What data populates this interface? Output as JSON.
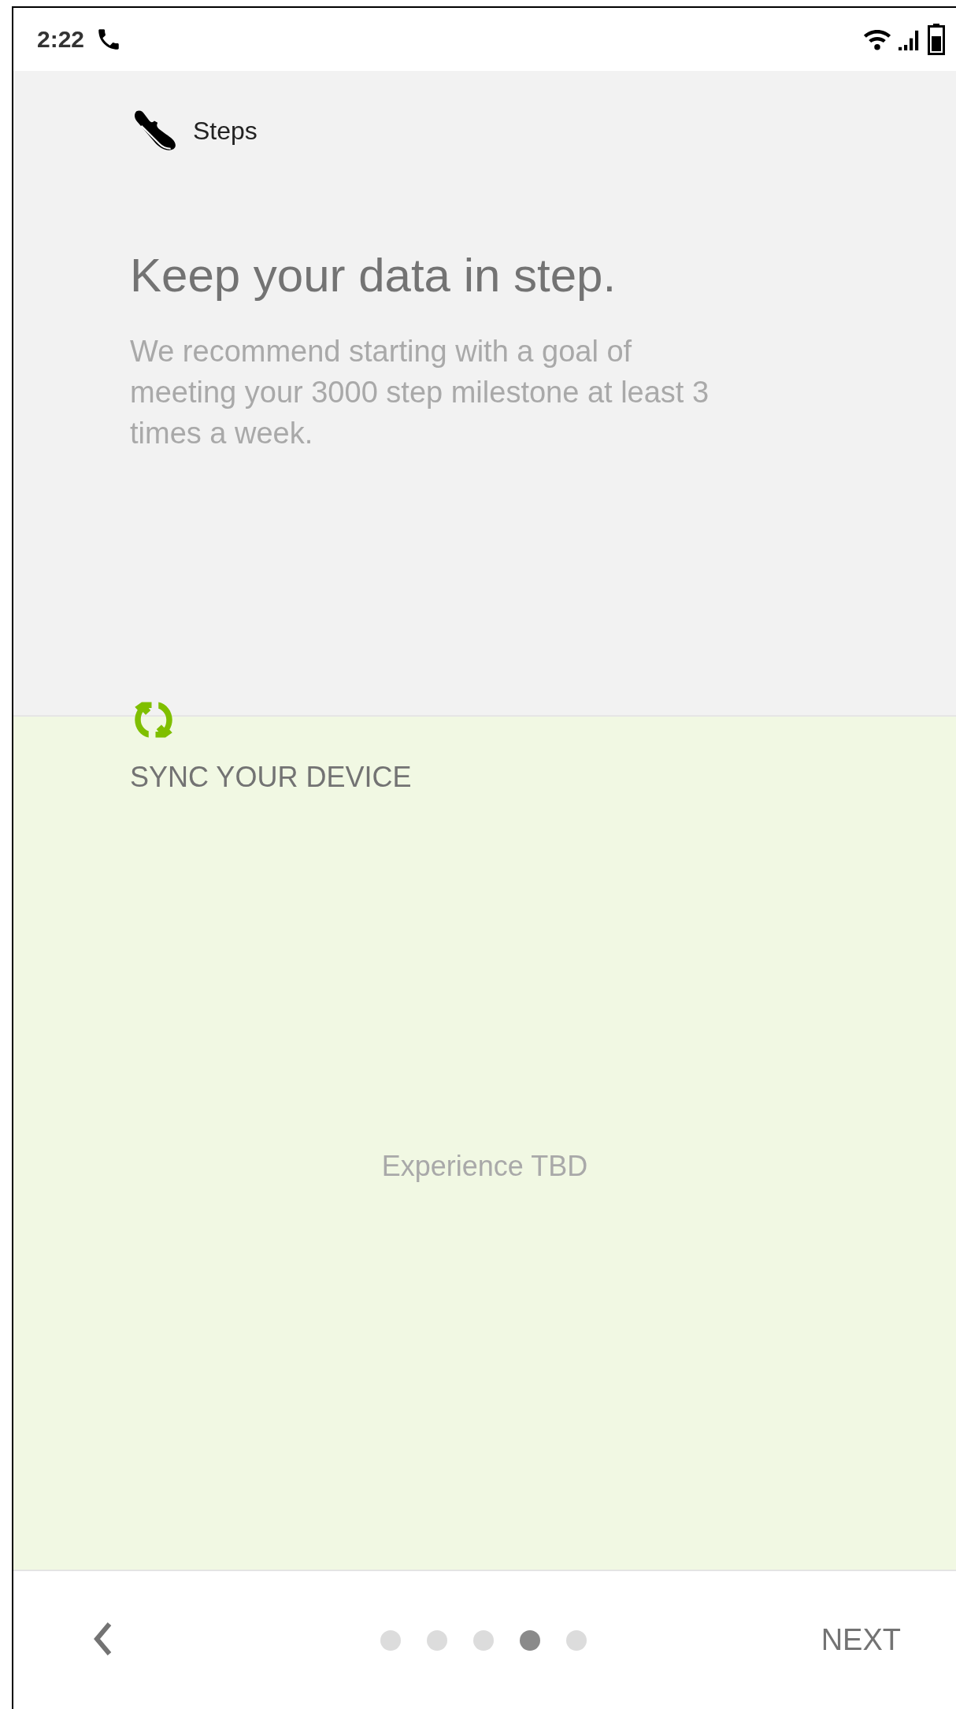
{
  "status_bar": {
    "time": "2:22"
  },
  "header": {
    "label": "Steps"
  },
  "title": "Keep your data in step.",
  "description": "We recommend starting with a goal of meeting your 3000 step milestone at least 3 times a week.",
  "sync_section": {
    "heading": "SYNC YOUR DEVICE",
    "placeholder_text": "Experience TBD"
  },
  "bottom_nav": {
    "pages": [
      {
        "selected": false
      },
      {
        "selected": false
      },
      {
        "selected": false
      },
      {
        "selected": true
      },
      {
        "selected": false
      }
    ],
    "next_label": "NEXT"
  }
}
